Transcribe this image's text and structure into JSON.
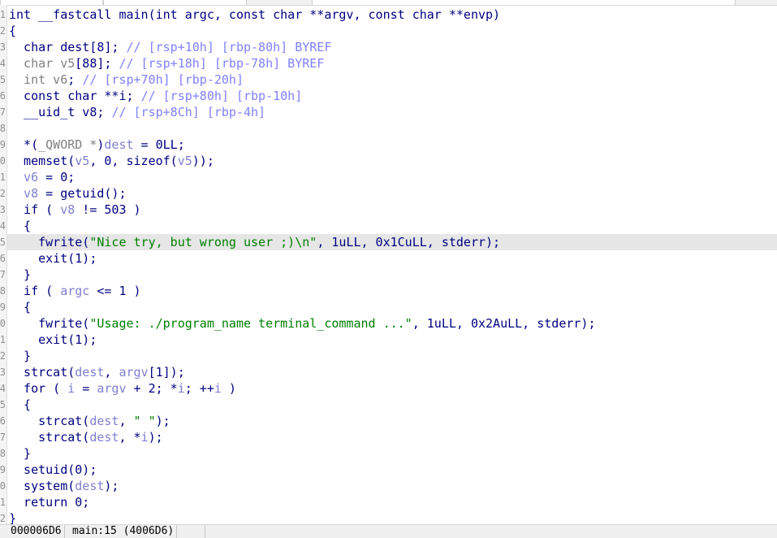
{
  "highlighted_line": 15,
  "colors": {
    "keyword": "#000080",
    "variable": "#7f7fd0",
    "comment": "#8080ff",
    "unused": "#808080",
    "string": "#008000",
    "highlight": "#e6e6e6"
  },
  "code_lines": [
    [
      {
        "c": "k",
        "t": "int __fastcall main(int argc, const char **argv, const char **envp)"
      }
    ],
    [
      {
        "c": "k",
        "t": "{"
      }
    ],
    [
      {
        "c": "k",
        "t": "  char dest[8]; "
      },
      {
        "c": "c",
        "t": "// [rsp+10h] [rbp-80h] BYREF"
      }
    ],
    [
      {
        "c": "g",
        "t": "  char v5"
      },
      {
        "c": "k",
        "t": "[88]; "
      },
      {
        "c": "c",
        "t": "// [rsp+18h] [rbp-78h] BYREF"
      }
    ],
    [
      {
        "c": "g",
        "t": "  int v6"
      },
      {
        "c": "k",
        "t": "; "
      },
      {
        "c": "c",
        "t": "// [rsp+70h] [rbp-20h]"
      }
    ],
    [
      {
        "c": "k",
        "t": "  const char **i; "
      },
      {
        "c": "c",
        "t": "// [rsp+80h] [rbp-10h]"
      }
    ],
    [
      {
        "c": "k",
        "t": "  __uid_t v8; "
      },
      {
        "c": "c",
        "t": "// [rsp+8Ch] [rbp-4h]"
      }
    ],
    [
      {
        "c": "k",
        "t": ""
      }
    ],
    [
      {
        "c": "k",
        "t": "  *("
      },
      {
        "c": "g",
        "t": "_QWORD *"
      },
      {
        "c": "k",
        "t": ")"
      },
      {
        "c": "v",
        "t": "dest"
      },
      {
        "c": "k",
        "t": " = 0LL;"
      }
    ],
    [
      {
        "c": "k",
        "t": "  memset("
      },
      {
        "c": "v",
        "t": "v5"
      },
      {
        "c": "k",
        "t": ", 0, sizeof("
      },
      {
        "c": "v",
        "t": "v5"
      },
      {
        "c": "k",
        "t": "));"
      }
    ],
    [
      {
        "c": "v",
        "t": "  v6"
      },
      {
        "c": "k",
        "t": " = 0;"
      }
    ],
    [
      {
        "c": "v",
        "t": "  v8"
      },
      {
        "c": "k",
        "t": " = getuid();"
      }
    ],
    [
      {
        "c": "k",
        "t": "  if ( "
      },
      {
        "c": "v",
        "t": "v8"
      },
      {
        "c": "k",
        "t": " != 503 )"
      }
    ],
    [
      {
        "c": "k",
        "t": "  {"
      }
    ],
    [
      {
        "c": "k",
        "t": "    fwrite("
      },
      {
        "c": "s",
        "t": "\"Nice try, but wrong user ;)\\n\""
      },
      {
        "c": "k",
        "t": ", 1uLL, 0x1CuLL, stderr);"
      }
    ],
    [
      {
        "c": "k",
        "t": "    exit(1);"
      }
    ],
    [
      {
        "c": "k",
        "t": "  }"
      }
    ],
    [
      {
        "c": "k",
        "t": "  if ( "
      },
      {
        "c": "v",
        "t": "argc"
      },
      {
        "c": "k",
        "t": " <= 1 )"
      }
    ],
    [
      {
        "c": "k",
        "t": "  {"
      }
    ],
    [
      {
        "c": "k",
        "t": "    fwrite("
      },
      {
        "c": "s",
        "t": "\"Usage: ./program_name terminal_command ...\""
      },
      {
        "c": "k",
        "t": ", 1uLL, 0x2AuLL, stderr);"
      }
    ],
    [
      {
        "c": "k",
        "t": "    exit(1);"
      }
    ],
    [
      {
        "c": "k",
        "t": "  }"
      }
    ],
    [
      {
        "c": "k",
        "t": "  strcat("
      },
      {
        "c": "v",
        "t": "dest"
      },
      {
        "c": "k",
        "t": ", "
      },
      {
        "c": "v",
        "t": "argv"
      },
      {
        "c": "k",
        "t": "[1]);"
      }
    ],
    [
      {
        "c": "k",
        "t": "  for ( "
      },
      {
        "c": "v",
        "t": "i"
      },
      {
        "c": "k",
        "t": " = "
      },
      {
        "c": "v",
        "t": "argv"
      },
      {
        "c": "k",
        "t": " + 2; *"
      },
      {
        "c": "v",
        "t": "i"
      },
      {
        "c": "k",
        "t": "; ++"
      },
      {
        "c": "v",
        "t": "i"
      },
      {
        "c": "k",
        "t": " )"
      }
    ],
    [
      {
        "c": "k",
        "t": "  {"
      }
    ],
    [
      {
        "c": "k",
        "t": "    strcat("
      },
      {
        "c": "v",
        "t": "dest"
      },
      {
        "c": "k",
        "t": ", "
      },
      {
        "c": "s",
        "t": "\" \""
      },
      {
        "c": "k",
        "t": ");"
      }
    ],
    [
      {
        "c": "k",
        "t": "    strcat("
      },
      {
        "c": "v",
        "t": "dest"
      },
      {
        "c": "k",
        "t": ", *"
      },
      {
        "c": "v",
        "t": "i"
      },
      {
        "c": "k",
        "t": ");"
      }
    ],
    [
      {
        "c": "k",
        "t": "  }"
      }
    ],
    [
      {
        "c": "k",
        "t": "  setuid(0);"
      }
    ],
    [
      {
        "c": "k",
        "t": "  system("
      },
      {
        "c": "v",
        "t": "dest"
      },
      {
        "c": "k",
        "t": ");"
      }
    ],
    [
      {
        "c": "k",
        "t": "  return 0;"
      }
    ],
    [
      {
        "c": "k",
        "t": "}"
      }
    ]
  ],
  "status": {
    "offset": "000006D6",
    "location": "main:15 (4006D6)"
  }
}
